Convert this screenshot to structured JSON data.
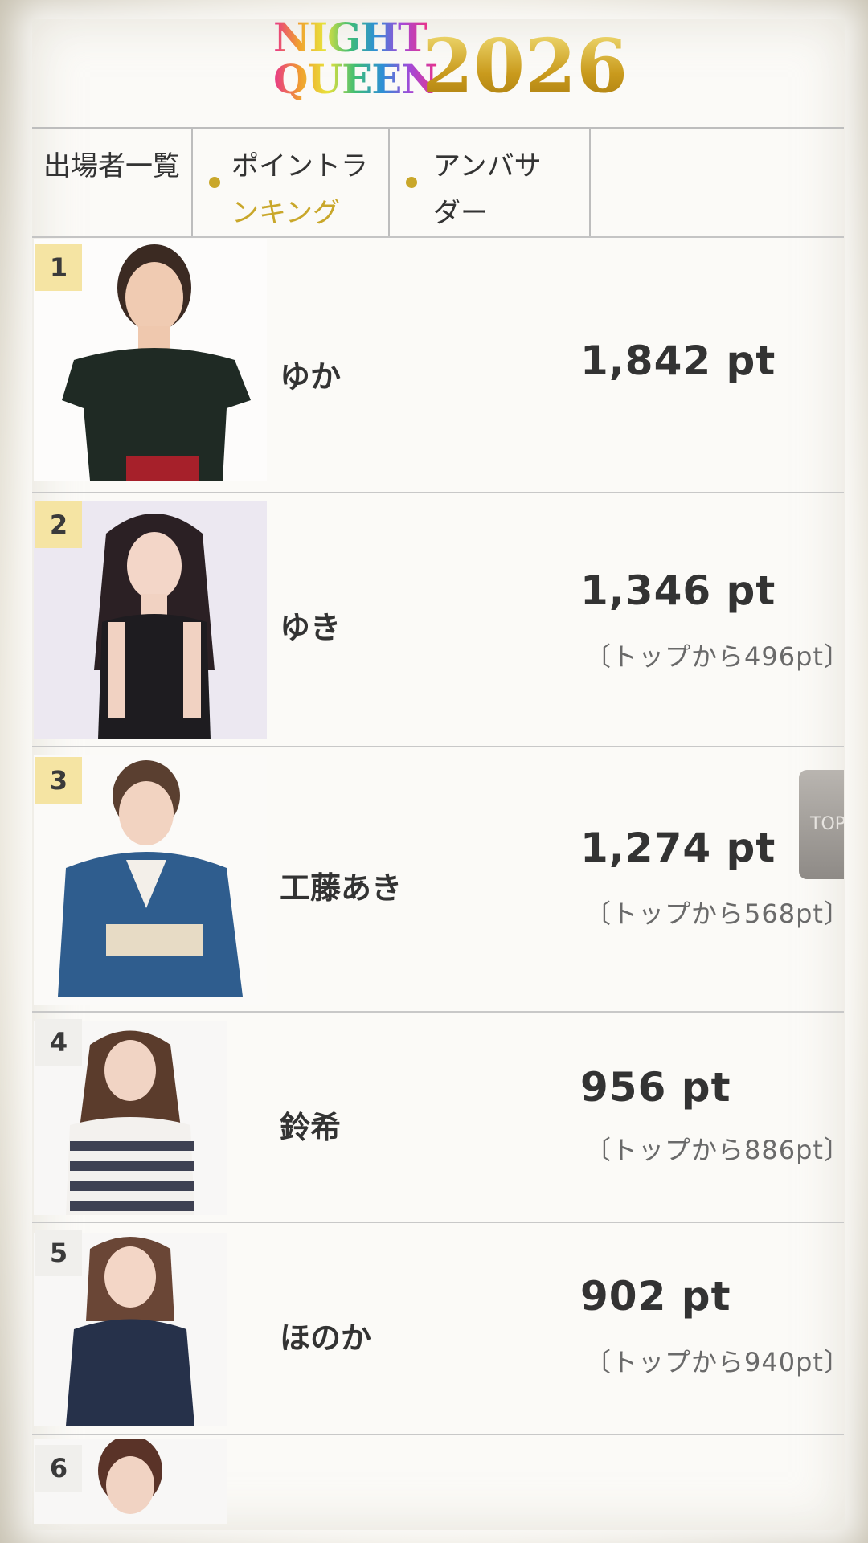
{
  "header": {
    "logo_line1": "NIGHT",
    "logo_line2": "QUEEN",
    "year": "2026"
  },
  "tabs": [
    {
      "label": "出場者一覧",
      "active": false
    },
    {
      "label_a": "ポイントラ",
      "label_b": "ンキング",
      "active": true
    },
    {
      "label_a": "アンバサ",
      "label_b": "ダー",
      "active": false
    }
  ],
  "ranking": [
    {
      "rank": "1",
      "name": "ゆか",
      "points": "1,842 pt",
      "diff": ""
    },
    {
      "rank": "2",
      "name": "ゆき",
      "points": "1,346 pt",
      "diff": "〔トップから496pt〕"
    },
    {
      "rank": "3",
      "name": "工藤あき",
      "points": "1,274 pt",
      "diff": "〔トップから568pt〕"
    },
    {
      "rank": "4",
      "name": "鈴希",
      "points": "956 pt",
      "diff": "〔トップから886pt〕"
    },
    {
      "rank": "5",
      "name": "ほのか",
      "points": "902 pt",
      "diff": "〔トップから940pt〕"
    },
    {
      "rank": "6",
      "name": "",
      "points": "",
      "diff": ""
    }
  ],
  "top_button": {
    "label": "TOP"
  },
  "colors": {
    "accent_gold": "#c9a72a",
    "rank_top_bg": "#f5e4a3"
  }
}
